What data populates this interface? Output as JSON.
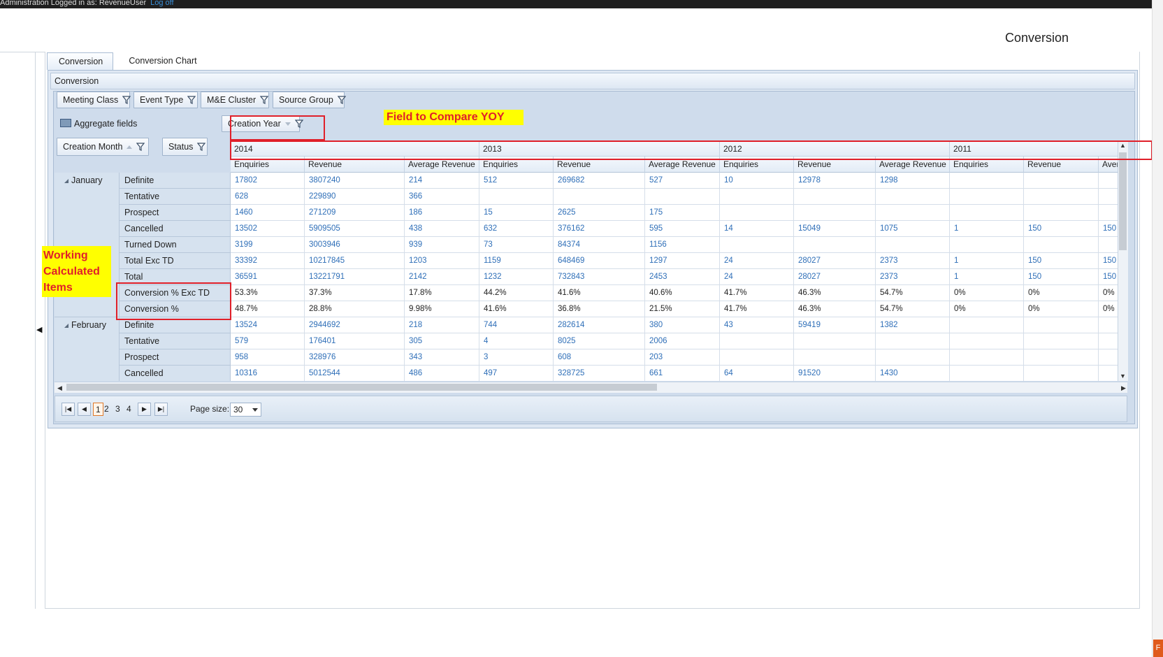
{
  "topbar": {
    "text": "Administration    Logged in as: RevenueUser",
    "logoff": "Log off"
  },
  "page_title": "Conversion",
  "tabs": [
    {
      "label": "Conversion",
      "active": true
    },
    {
      "label": "Conversion Chart",
      "active": false
    }
  ],
  "panel_header": "Conversion",
  "filter_fields": [
    "Meeting Class",
    "Event Type",
    "M&E Cluster",
    "Source Group"
  ],
  "aggregate_label": "Aggregate fields",
  "column_field": "Creation Year",
  "row_fields": [
    "Creation Month",
    "Status"
  ],
  "annotations": {
    "compare": "Field to Compare YOY",
    "calculated": [
      "Working",
      "Calculated",
      "Items"
    ]
  },
  "years": [
    "2014",
    "2013",
    "2012",
    "2011"
  ],
  "measures": [
    "Enquiries",
    "Revenue",
    "Average Revenue"
  ],
  "rows": [
    {
      "month": "January",
      "status": "Definite",
      "values": [
        "17802",
        "3807240",
        "214",
        "512",
        "269682",
        "527",
        "10",
        "12978",
        "1298",
        "",
        "",
        ""
      ]
    },
    {
      "month": "January",
      "status": "Tentative",
      "values": [
        "628",
        "229890",
        "366",
        "",
        "",
        "",
        "",
        "",
        "",
        "",
        "",
        ""
      ]
    },
    {
      "month": "January",
      "status": "Prospect",
      "values": [
        "1460",
        "271209",
        "186",
        "15",
        "2625",
        "175",
        "",
        "",
        "",
        "",
        "",
        ""
      ]
    },
    {
      "month": "January",
      "status": "Cancelled",
      "values": [
        "13502",
        "5909505",
        "438",
        "632",
        "376162",
        "595",
        "14",
        "15049",
        "1075",
        "1",
        "150",
        "150"
      ]
    },
    {
      "month": "January",
      "status": "Turned Down",
      "values": [
        "3199",
        "3003946",
        "939",
        "73",
        "84374",
        "1156",
        "",
        "",
        "",
        "",
        "",
        ""
      ]
    },
    {
      "month": "January",
      "status": "Total Exc TD",
      "values": [
        "33392",
        "10217845",
        "1203",
        "1159",
        "648469",
        "1297",
        "24",
        "28027",
        "2373",
        "1",
        "150",
        "150"
      ]
    },
    {
      "month": "January",
      "status": "Total",
      "values": [
        "36591",
        "13221791",
        "2142",
        "1232",
        "732843",
        "2453",
        "24",
        "28027",
        "2373",
        "1",
        "150",
        "150"
      ]
    },
    {
      "month": "January",
      "status": "Conversion % Exc TD",
      "values": [
        "53.3%",
        "37.3%",
        "17.8%",
        "44.2%",
        "41.6%",
        "40.6%",
        "41.7%",
        "46.3%",
        "54.7%",
        "0%",
        "0%",
        "0%"
      ]
    },
    {
      "month": "January",
      "status": "Conversion %",
      "values": [
        "48.7%",
        "28.8%",
        "9.98%",
        "41.6%",
        "36.8%",
        "21.5%",
        "41.7%",
        "46.3%",
        "54.7%",
        "0%",
        "0%",
        "0%"
      ]
    },
    {
      "month": "February",
      "status": "Definite",
      "values": [
        "13524",
        "2944692",
        "218",
        "744",
        "282614",
        "380",
        "43",
        "59419",
        "1382",
        "",
        "",
        ""
      ]
    },
    {
      "month": "February",
      "status": "Tentative",
      "values": [
        "579",
        "176401",
        "305",
        "4",
        "8025",
        "2006",
        "",
        "",
        "",
        "",
        "",
        ""
      ]
    },
    {
      "month": "February",
      "status": "Prospect",
      "values": [
        "958",
        "328976",
        "343",
        "3",
        "608",
        "203",
        "",
        "",
        "",
        "",
        "",
        ""
      ]
    },
    {
      "month": "February",
      "status": "Cancelled",
      "values": [
        "10316",
        "5012544",
        "486",
        "497",
        "328725",
        "661",
        "64",
        "91520",
        "1430",
        "",
        "",
        ""
      ]
    }
  ],
  "months": [
    "January",
    "February"
  ],
  "pager": {
    "pages": [
      "1",
      "2",
      "3",
      "4"
    ],
    "current": "1",
    "page_size_label": "Page size:",
    "page_size": "30"
  },
  "colors": {
    "link_blue": "#2f6fb8",
    "annotation_red": "#e0202a",
    "annotation_yellow": "#ffff00",
    "pager_current": "#e07a2a"
  }
}
